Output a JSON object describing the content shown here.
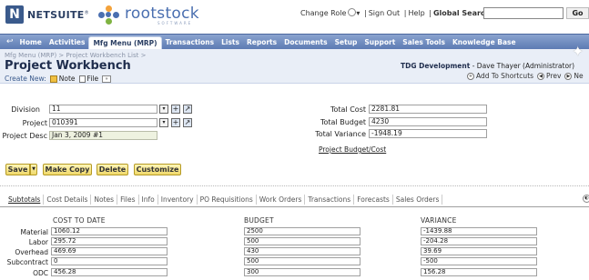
{
  "header": {
    "netsuite_logo": "NETSUITE",
    "logo_mark": "N",
    "rootstock_logo": "rootstock",
    "rootstock_tagline": "SOFTWARE",
    "change_role": "Change Role",
    "sign_out": "Sign Out",
    "help": "Help",
    "global_search_label": "Global Search",
    "global_search_value": "",
    "go_label": "Go",
    "sep": "|"
  },
  "nav": {
    "tabs": [
      {
        "label": "Home",
        "active": false
      },
      {
        "label": "Activities",
        "active": false
      },
      {
        "label": "Mfg Menu (MRP)",
        "active": true
      },
      {
        "label": "Transactions",
        "active": false
      },
      {
        "label": "Lists",
        "active": false
      },
      {
        "label": "Reports",
        "active": false
      },
      {
        "label": "Documents",
        "active": false
      },
      {
        "label": "Setup",
        "active": false
      },
      {
        "label": "Support",
        "active": false
      },
      {
        "label": "Sales Tools",
        "active": false
      },
      {
        "label": "Knowledge Base",
        "active": false
      }
    ]
  },
  "subheader": {
    "breadcrumb": "Mfg Menu (MRP) > Project Workbench List >",
    "title": "Project Workbench",
    "create_new_label": "Create New:",
    "create_note": "Note",
    "create_file": "File",
    "company": "TDG Development",
    "user": " - Dave Thayer (Administrator)",
    "add_shortcuts": "Add To Shortcuts",
    "prev": "Prev",
    "next": "Ne"
  },
  "form": {
    "division_label": "Division",
    "division_value": "11",
    "project_label": "Project",
    "project_value": "010391",
    "project_desc_label": "Project Desc",
    "project_desc_value": "Jan 3, 2009 #1",
    "total_cost_label": "Total Cost",
    "total_cost_value": "2281.81",
    "total_budget_label": "Total Budget",
    "total_budget_value": "4230",
    "total_variance_label": "Total Variance",
    "total_variance_value": "-1948.19",
    "project_budget_link": "Project Budget/Cost"
  },
  "buttons": {
    "save": "Save",
    "make_copy": "Make Copy",
    "delete": "Delete",
    "customize": "Customize"
  },
  "subtabs": [
    {
      "label": "Subtotals",
      "active": true
    },
    {
      "label": "Cost Details",
      "active": false
    },
    {
      "label": "Notes",
      "active": false
    },
    {
      "label": "Files",
      "active": false
    },
    {
      "label": "Info",
      "active": false
    },
    {
      "label": "Inventory",
      "active": false
    },
    {
      "label": "PO Requisitions",
      "active": false
    },
    {
      "label": "Work Orders",
      "active": false
    },
    {
      "label": "Transactions",
      "active": false
    },
    {
      "label": "Forecasts",
      "active": false
    },
    {
      "label": "Sales Orders",
      "active": false
    }
  ],
  "subtotals": {
    "headers": [
      "COST TO DATE",
      "BUDGET",
      "VARIANCE"
    ],
    "rows": [
      {
        "label": "Material",
        "cost": "1060.12",
        "budget": "2500",
        "variance": "-1439.88"
      },
      {
        "label": "Labor",
        "cost": "295.72",
        "budget": "500",
        "variance": "-204.28"
      },
      {
        "label": "Overhead",
        "cost": "469.69",
        "budget": "430",
        "variance": "39.69"
      },
      {
        "label": "Subcontract",
        "cost": "0",
        "budget": "500",
        "variance": "-500"
      },
      {
        "label": "ODC",
        "cost": "456.28",
        "budget": "300",
        "variance": "156.28"
      }
    ]
  },
  "colors": {
    "nav_bg": "#5d7bb3",
    "button_bg": "#efd86a",
    "subheader_bg": "#e9eef7"
  }
}
